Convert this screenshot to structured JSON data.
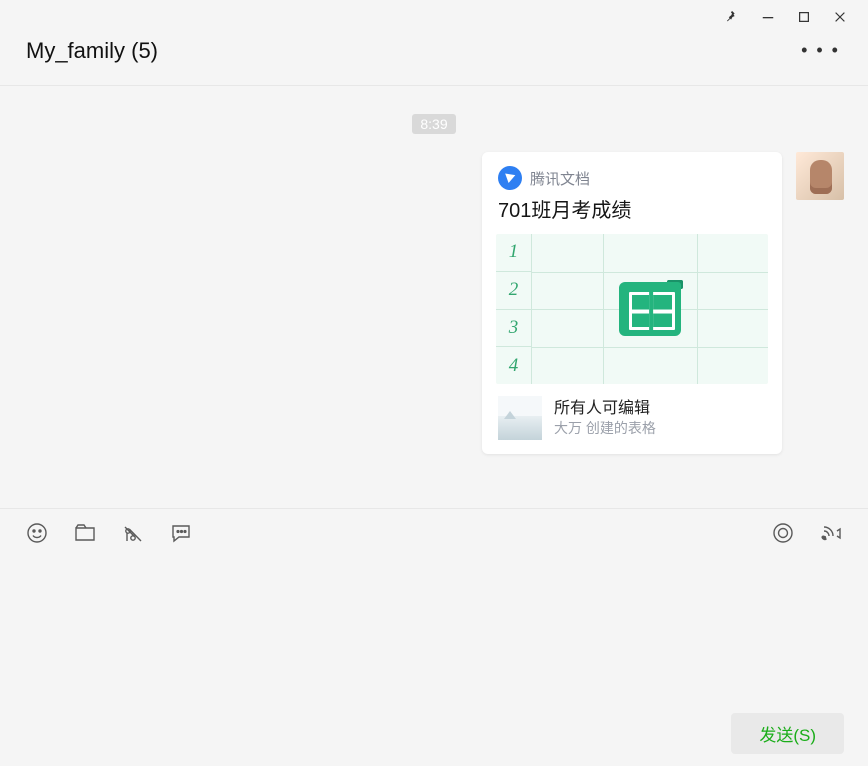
{
  "window": {
    "title": "My_family (5)"
  },
  "chat": {
    "timestamp": "8:39",
    "card": {
      "app_name": "腾讯文档",
      "title": "701班月考成绩",
      "row_numbers": [
        "1",
        "2",
        "3",
        "4"
      ],
      "perm_title": "所有人可编辑",
      "perm_sub": "大万 创建的表格"
    }
  },
  "send": {
    "label": "发送(S)"
  }
}
